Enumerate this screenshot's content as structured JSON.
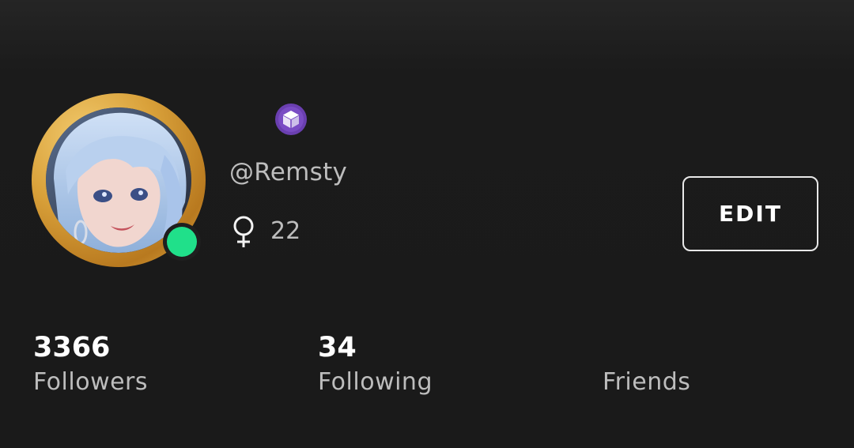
{
  "profile": {
    "username": "@Remsty",
    "age": "22",
    "gender_icon": "female-symbol-icon",
    "badge_icon": "cube-badge-icon",
    "online": true,
    "accent_colors": {
      "avatar_ring": "#d9a13a",
      "online_dot": "#20e08a",
      "badge": "#6a3fb0"
    }
  },
  "actions": {
    "edit_label": "EDIT"
  },
  "stats": {
    "followers": {
      "value": "3366",
      "label": "Followers"
    },
    "following": {
      "value": "34",
      "label": "Following"
    },
    "friends": {
      "value": "",
      "label": "Friends"
    }
  }
}
